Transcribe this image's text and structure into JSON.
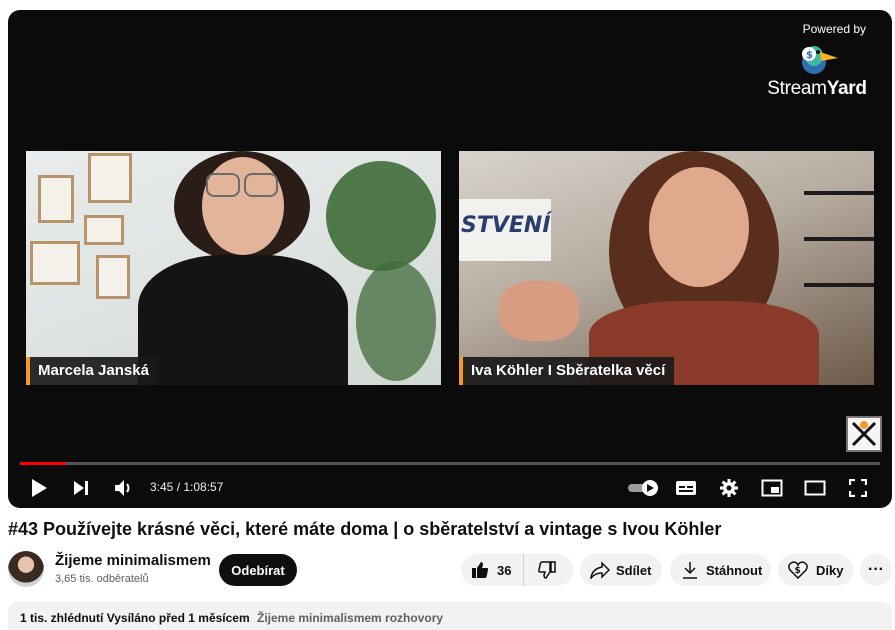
{
  "player": {
    "powered_by": "Powered by",
    "streamyard_word_light": "Stream",
    "streamyard_word_bold": "Yard",
    "participants": [
      {
        "name": "Marcela Janská"
      },
      {
        "name": "Iva Köhler I Sběratelka věcí"
      }
    ],
    "backdrop_sign": "STVENÍ",
    "time": "3:45 / 1:08:57",
    "progress_fraction": 0.054,
    "accent_color": "#ff0000",
    "name_tag_accent": "#f59a23",
    "controls": {
      "play": "play-icon",
      "next": "next-icon",
      "volume": "volume-icon",
      "autoplay": "autoplay-toggle-icon",
      "captions": "captions-icon",
      "settings": "gear-icon",
      "miniplayer": "miniplayer-icon",
      "theater": "theater-icon",
      "fullscreen": "fullscreen-icon"
    }
  },
  "video": {
    "title": "#43 Používejte krásné věci, které máte doma | o sběratelství a vintage s Ivou Köhler"
  },
  "channel": {
    "name": "Žijeme minimalismem",
    "subscribers": "3,65 tis. odběratelů",
    "subscribe_label": "Odebírat"
  },
  "actions": {
    "likes": "36",
    "share_label": "Sdílet",
    "download_label": "Stáhnout",
    "thanks_label": "Díky",
    "more_label": "···"
  },
  "description": {
    "views": "1 tis. zhlédnutí",
    "published": "Vysíláno před 1 měsícem",
    "playlist": "Žijeme minimalismem rozhovory"
  }
}
